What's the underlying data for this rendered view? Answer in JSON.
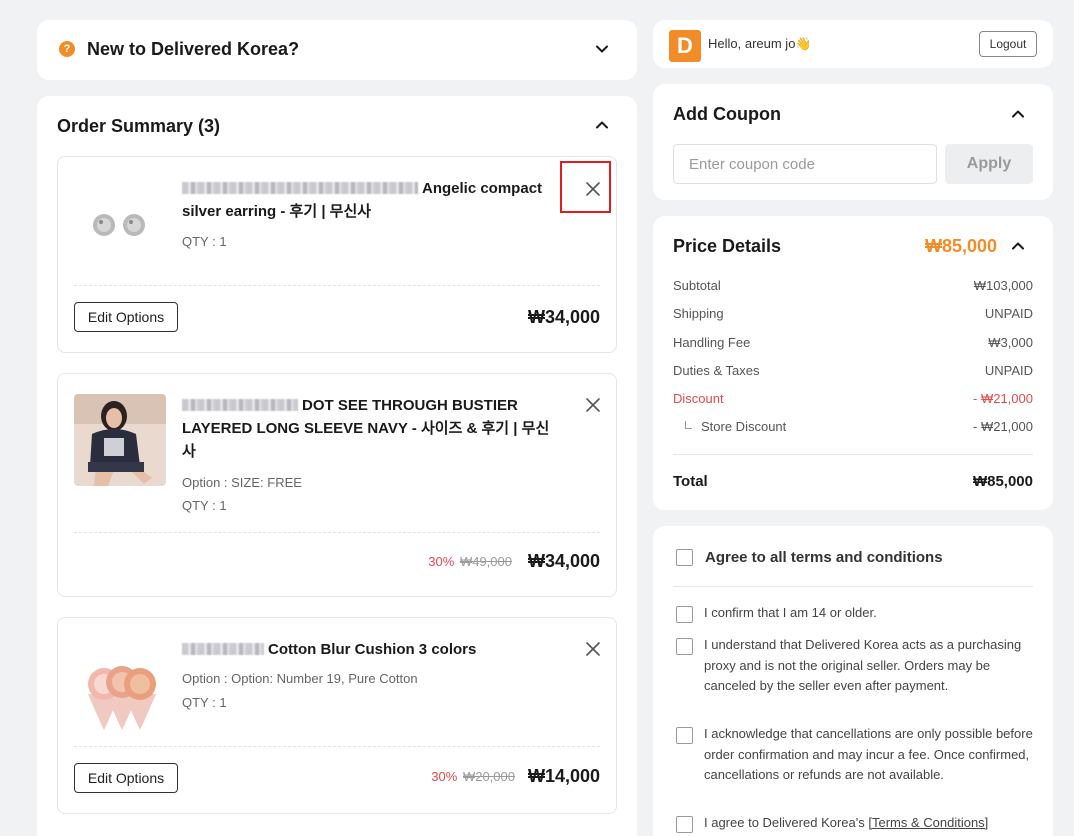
{
  "faq": {
    "title": "New to Delivered Korea?"
  },
  "order": {
    "title": "Order Summary (3)",
    "edit_label": "Edit Options",
    "items": [
      {
        "name": "Angelic compact silver earring - 후기 | 무신사",
        "qty": "QTY : 1",
        "price": "₩34,000"
      },
      {
        "name": "DOT SEE THROUGH BUSTIER LAYERED LONG SLEEVE NAVY - 사이즈 & 후기 | 무신사",
        "option": "Option : SIZE: FREE",
        "qty": "QTY : 1",
        "discount": "30%",
        "original_price": "₩49,000",
        "price": "₩34,000"
      },
      {
        "name": "Cotton Blur Cushion 3 colors",
        "option": "Option : Option: Number 19, Pure Cotton",
        "qty": "QTY : 1",
        "discount": "30%",
        "original_price": "₩20,000",
        "price": "₩14,000"
      }
    ]
  },
  "user": {
    "logo_letter": "D",
    "greeting": "Hello, areum jo👋",
    "logout_label": "Logout"
  },
  "coupon": {
    "title": "Add Coupon",
    "placeholder": "Enter coupon code",
    "apply_label": "Apply"
  },
  "price": {
    "title": "Price Details",
    "header_total": "₩85,000",
    "rows": [
      {
        "label": "Subtotal",
        "value": "₩103,000"
      },
      {
        "label": "Shipping",
        "value": "UNPAID"
      },
      {
        "label": "Handling Fee",
        "value": "₩3,000"
      },
      {
        "label": "Duties & Taxes",
        "value": "UNPAID"
      },
      {
        "label": "Discount",
        "value": "- ₩21,000"
      },
      {
        "label": "Store Discount",
        "value": "- ₩21,000"
      }
    ],
    "total_label": "Total",
    "total_value": "₩85,000"
  },
  "terms": {
    "all": "Agree to all terms and conditions",
    "items": [
      "I confirm that I am 14 or older.",
      "I understand that Delivered Korea acts as a purchasing proxy and is not the original seller. Orders may be canceled by the seller even after payment.",
      "I acknowledge that cancellations are only possible before order confirmation and may incur a fee. Once confirmed, cancellations or refunds are not available."
    ],
    "last_prefix": "I agree to Delivered Korea's ",
    "last_link": "[Terms & Conditions]"
  },
  "colors": {
    "accent": "#f28c28",
    "discount": "#e5484d",
    "highlight": "#e11d1d"
  }
}
